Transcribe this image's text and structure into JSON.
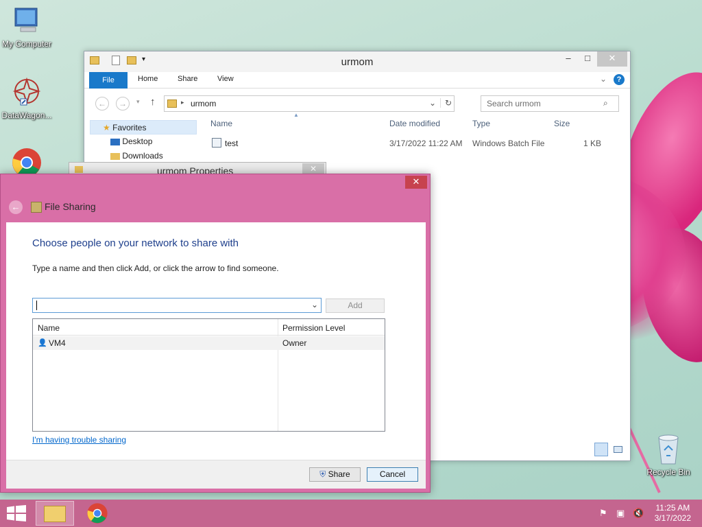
{
  "desktop": {
    "icons": [
      {
        "label": "My Computer",
        "icon": "computer-icon"
      },
      {
        "label": "DataWagon...",
        "icon": "datawagon-icon"
      },
      {
        "label": "Google Chrome",
        "icon": "chrome-icon"
      },
      {
        "label": "Recycle Bin",
        "icon": "recycle-bin-icon"
      }
    ]
  },
  "explorer": {
    "title": "urmom",
    "ribbon_tabs": {
      "file": "File",
      "home": "Home",
      "share": "Share",
      "view": "View"
    },
    "address": "urmom",
    "search_placeholder": "Search urmom",
    "nav": {
      "favorites": "Favorites",
      "desktop": "Desktop",
      "downloads": "Downloads"
    },
    "columns": {
      "name": "Name",
      "date": "Date modified",
      "type": "Type",
      "size": "Size"
    },
    "files": [
      {
        "name": "test",
        "date": "3/17/2022 11:22 AM",
        "type": "Windows Batch File",
        "size": "1 KB"
      }
    ]
  },
  "properties_window": {
    "title": "urmom Properties"
  },
  "dialog": {
    "title": "File Sharing",
    "heading": "Choose people on your network to share with",
    "instruction": "Type a name and then click Add, or click the arrow to find someone.",
    "name_input_value": "",
    "add_button": "Add",
    "columns": {
      "name": "Name",
      "permission": "Permission Level"
    },
    "people": [
      {
        "name": "VM4",
        "permission": "Owner"
      }
    ],
    "trouble_link": "I'm having trouble sharing",
    "share_button": "Share",
    "cancel_button": "Cancel"
  },
  "taskbar": {
    "time": "11:25 AM",
    "date": "3/17/2022"
  },
  "colors": {
    "dialog_accent": "#d96fa7",
    "taskbar": "#c4658f",
    "heading_blue": "#1e3f8c",
    "link_blue": "#0066cc",
    "file_tab": "#1979ca",
    "close_red": "#c7424e"
  }
}
